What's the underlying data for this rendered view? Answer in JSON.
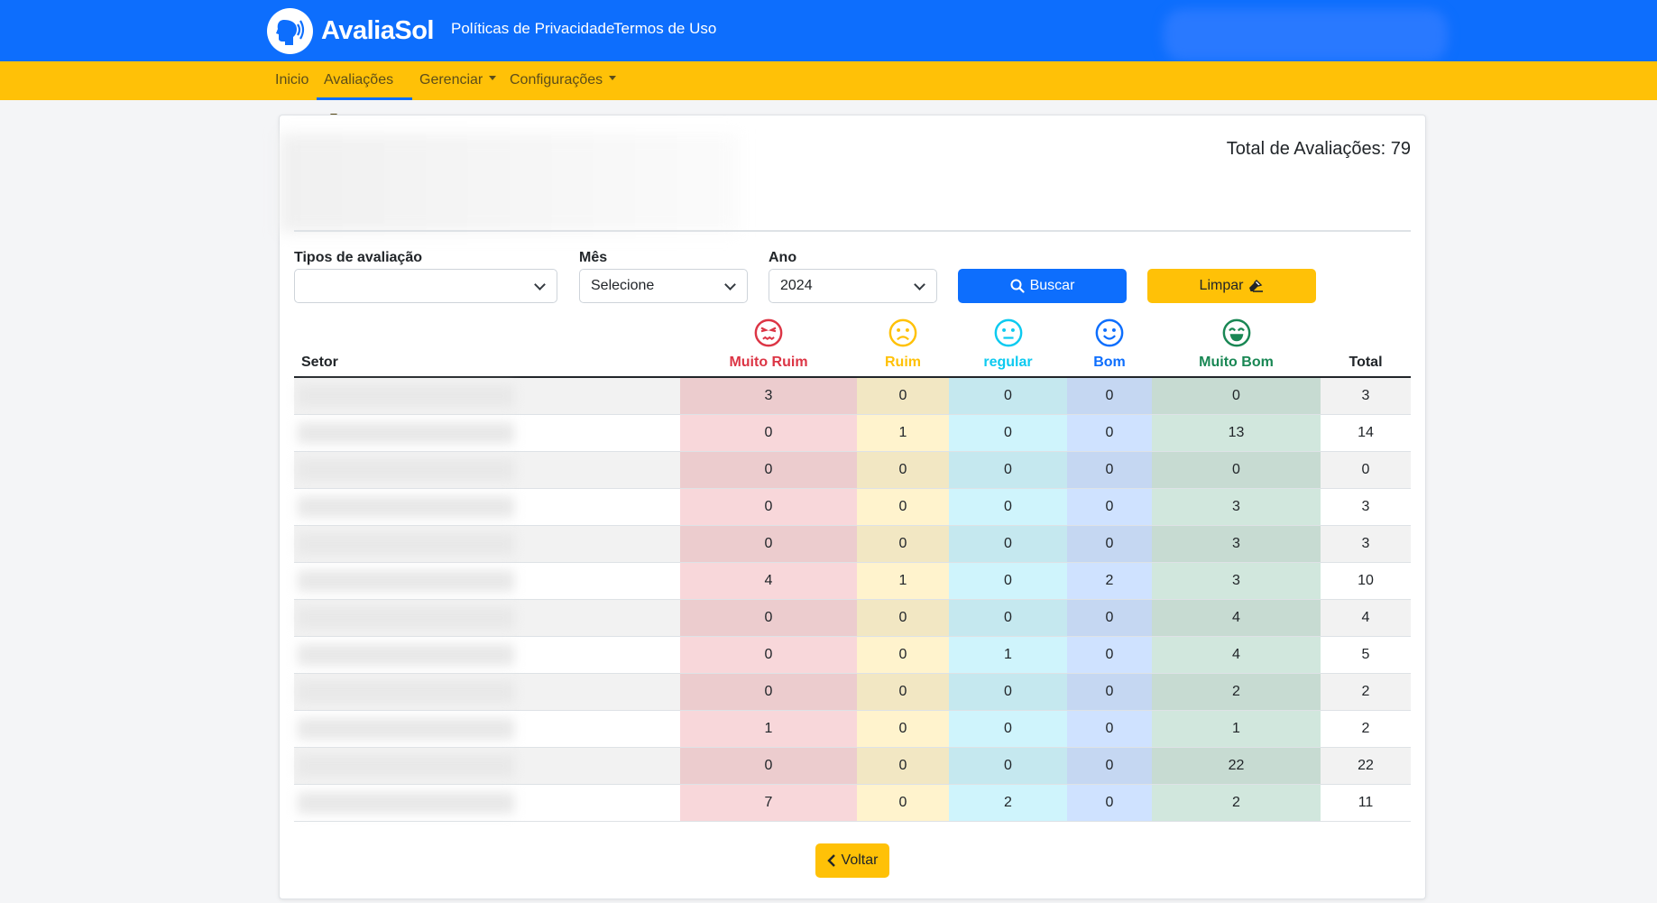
{
  "header": {
    "brand": "AvaliaSol",
    "links": [
      "Políticas de Privacidade",
      "Termos de Uso"
    ]
  },
  "nav": {
    "items": [
      "Inicio",
      "Avaliações",
      "Gerenciar",
      "Configurações"
    ]
  },
  "card": {
    "total_label": "Total de Avaliações: 79"
  },
  "filters": {
    "tipo_label": "Tipos de avaliação",
    "tipo_value": "",
    "mes_label": "Mês",
    "mes_value": "Selecione",
    "ano_label": "Ano",
    "ano_value": "2024",
    "buscar_label": "Buscar",
    "limpar_label": "Limpar"
  },
  "table": {
    "setor_header": "Setor",
    "total_header": "Total",
    "categories": [
      {
        "label": "Muito Ruim",
        "color": "#dc3545",
        "cell_even": "#f8d7da",
        "cell_odd": "#ecccce",
        "face": "very-bad"
      },
      {
        "label": "Ruim",
        "color": "#ffc107",
        "cell_even": "#fff3cd",
        "cell_odd": "#f2e7c3",
        "face": "bad"
      },
      {
        "label": "regular",
        "color": "#0dcaf0",
        "cell_even": "#cff4fc",
        "cell_odd": "#c5e8ef",
        "face": "neutral"
      },
      {
        "label": "Bom",
        "color": "#0d6efd",
        "cell_even": "#cfe2ff",
        "cell_odd": "#c5d7f2",
        "face": "good"
      },
      {
        "label": "Muito Bom",
        "color": "#198754",
        "cell_even": "#d1e7dd",
        "cell_odd": "#c7dbd2",
        "face": "very-good"
      }
    ],
    "rows": [
      {
        "values": [
          "3",
          "0",
          "0",
          "0",
          "0"
        ],
        "total": "3"
      },
      {
        "values": [
          "0",
          "1",
          "0",
          "0",
          "13"
        ],
        "total": "14"
      },
      {
        "values": [
          "0",
          "0",
          "0",
          "0",
          "0"
        ],
        "total": "0"
      },
      {
        "values": [
          "0",
          "0",
          "0",
          "0",
          "3"
        ],
        "total": "3"
      },
      {
        "values": [
          "0",
          "0",
          "0",
          "0",
          "3"
        ],
        "total": "3"
      },
      {
        "values": [
          "4",
          "1",
          "0",
          "2",
          "3"
        ],
        "total": "10"
      },
      {
        "values": [
          "0",
          "0",
          "0",
          "0",
          "4"
        ],
        "total": "4"
      },
      {
        "values": [
          "0",
          "0",
          "1",
          "0",
          "4"
        ],
        "total": "5"
      },
      {
        "values": [
          "0",
          "0",
          "0",
          "0",
          "2"
        ],
        "total": "2"
      },
      {
        "values": [
          "1",
          "0",
          "0",
          "0",
          "1"
        ],
        "total": "2"
      },
      {
        "values": [
          "0",
          "0",
          "0",
          "0",
          "22"
        ],
        "total": "22"
      },
      {
        "values": [
          "7",
          "0",
          "2",
          "0",
          "2"
        ],
        "total": "11"
      }
    ]
  },
  "back_label": "Voltar"
}
